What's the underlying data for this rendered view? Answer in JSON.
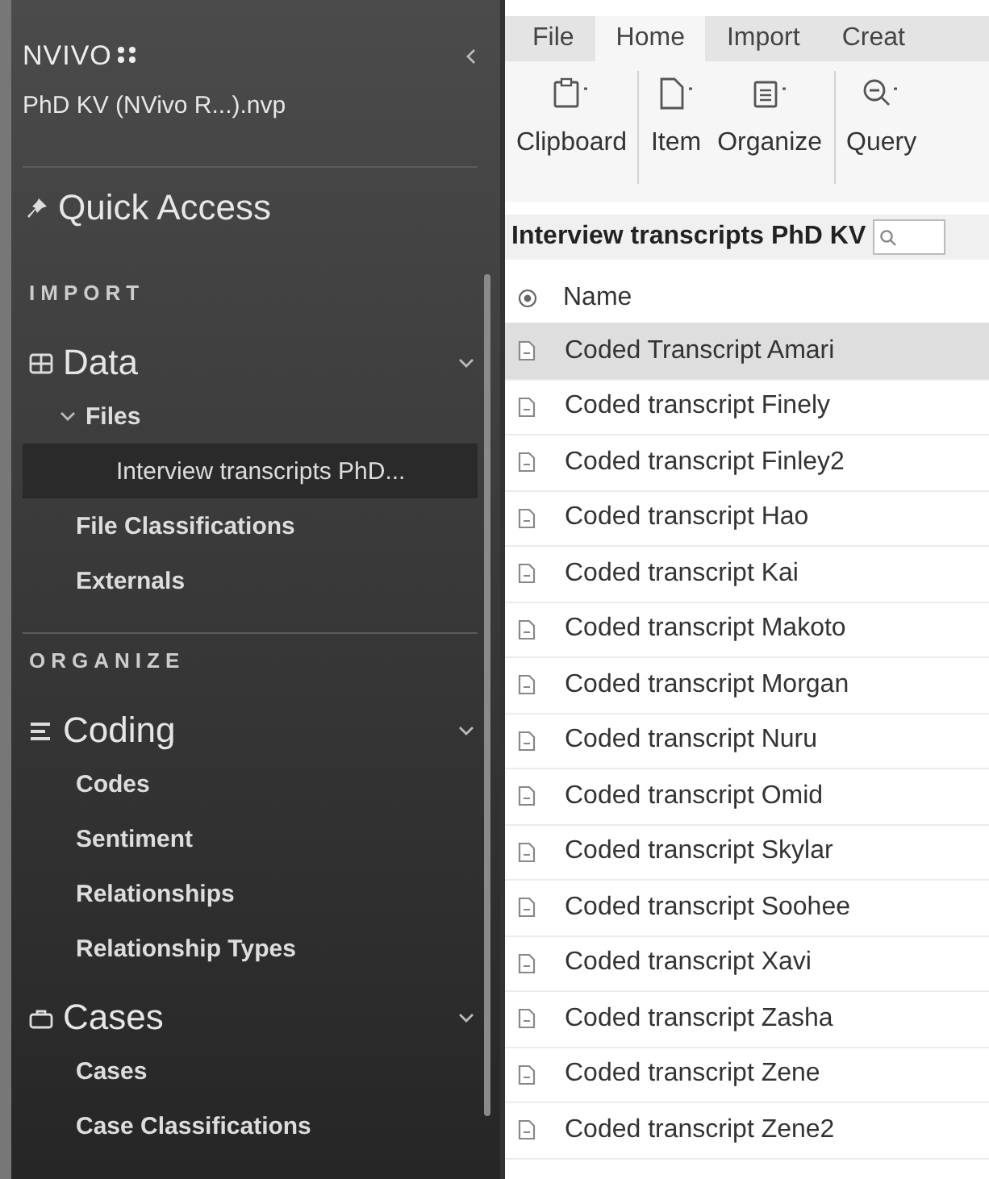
{
  "sidebar": {
    "app_name": "NVIVO",
    "project": "PhD KV (NVivo R...).nvp",
    "quick_access": "Quick Access",
    "sections": [
      {
        "heading": "IMPORT",
        "groups": [
          {
            "label": "Data",
            "kind": "data",
            "expanded": true,
            "items": [
              {
                "label": "Files",
                "selected": false,
                "expanded": true,
                "children": [
                  {
                    "label": "Interview transcripts PhD...",
                    "selected": true
                  }
                ]
              },
              {
                "label": "File Classifications",
                "selected": false
              },
              {
                "label": "Externals",
                "selected": false
              }
            ]
          }
        ]
      },
      {
        "heading": "ORGANIZE",
        "groups": [
          {
            "label": "Coding",
            "kind": "coding",
            "expanded": true,
            "items": [
              {
                "label": "Codes",
                "selected": false
              },
              {
                "label": "Sentiment",
                "selected": false
              },
              {
                "label": "Relationships",
                "selected": false
              },
              {
                "label": "Relationship Types",
                "selected": false
              }
            ]
          },
          {
            "label": "Cases",
            "kind": "cases",
            "expanded": true,
            "items": [
              {
                "label": "Cases",
                "selected": false
              },
              {
                "label": "Case Classifications",
                "selected": false
              }
            ]
          }
        ]
      }
    ]
  },
  "ribbon": {
    "tabs": [
      {
        "label": "File",
        "selected": false
      },
      {
        "label": "Home",
        "selected": true
      },
      {
        "label": "Import",
        "selected": false
      },
      {
        "label": "Creat",
        "selected": false
      }
    ],
    "groups": [
      [
        {
          "label": "Clipboard",
          "kind": "clipboard"
        }
      ],
      [
        {
          "label": "Item",
          "kind": "item"
        },
        {
          "label": "Organize",
          "kind": "organize"
        }
      ],
      [
        {
          "label": "Query",
          "kind": "query"
        }
      ]
    ]
  },
  "list": {
    "title": "Interview transcripts PhD KV",
    "column": "Name",
    "rows": [
      {
        "name": "Coded Transcript Amari",
        "selected": true
      },
      {
        "name": "Coded transcript Finely",
        "selected": false
      },
      {
        "name": "Coded transcript Finley2",
        "selected": false
      },
      {
        "name": "Coded transcript Hao",
        "selected": false
      },
      {
        "name": "Coded transcript Kai",
        "selected": false
      },
      {
        "name": "Coded transcript Makoto",
        "selected": false
      },
      {
        "name": "Coded transcript Morgan",
        "selected": false
      },
      {
        "name": "Coded transcript Nuru",
        "selected": false
      },
      {
        "name": "Coded transcript Omid",
        "selected": false
      },
      {
        "name": "Coded transcript Skylar",
        "selected": false
      },
      {
        "name": "Coded transcript Soohee",
        "selected": false
      },
      {
        "name": "Coded transcript Xavi",
        "selected": false
      },
      {
        "name": "Coded transcript Zasha",
        "selected": false
      },
      {
        "name": "Coded transcript Zene",
        "selected": false
      },
      {
        "name": "Coded transcript Zene2",
        "selected": false
      }
    ]
  }
}
